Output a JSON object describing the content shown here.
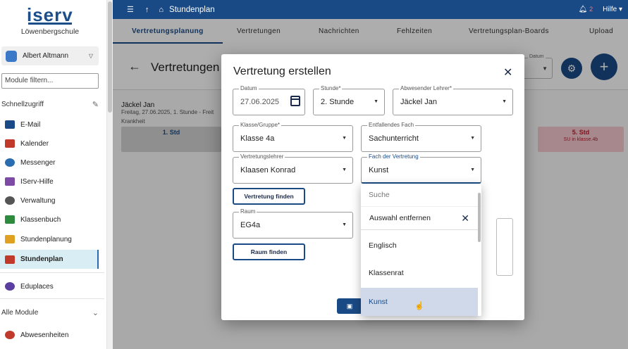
{
  "sidebar": {
    "logo": "iserv",
    "school": "Löwenbergschule",
    "user": "Albert Altmann",
    "filter_placeholder": "Module filtern...",
    "quick_access": "Schnellzugriff",
    "items": [
      {
        "label": "E-Mail",
        "icon": "mail-icon",
        "color": "#1a4a85"
      },
      {
        "label": "Kalender",
        "icon": "calendar-icon",
        "color": "#c0392b"
      },
      {
        "label": "Messenger",
        "icon": "messenger-icon",
        "color": "#2a6cb0"
      },
      {
        "label": "IServ-Hilfe",
        "icon": "help-icon",
        "color": "#7d4aa5"
      },
      {
        "label": "Verwaltung",
        "icon": "gear-icon",
        "color": "#555555"
      },
      {
        "label": "Klassenbuch",
        "icon": "classbook-icon",
        "color": "#2e8b3e"
      },
      {
        "label": "Stundenplanung",
        "icon": "planning-icon",
        "color": "#e0a020"
      },
      {
        "label": "Stundenplan",
        "icon": "timetable-icon",
        "color": "#c0392b"
      }
    ],
    "eduplaces": "Eduplaces",
    "all_modules": "Alle Module",
    "absences": "Abwesenheiten"
  },
  "topbar": {
    "title": "Stundenplan",
    "notifications": "2",
    "help": "Hilfe"
  },
  "tabs": [
    "Vertretungsplanung",
    "Vertretungen",
    "Nachrichten",
    "Fehlzeiten",
    "Vertretungsplan-Boards",
    "Upload"
  ],
  "page": {
    "title": "Vertretungen",
    "date_label": "Datum",
    "teacher": "Jäckel Jan",
    "teacher_sub": "Freitag, 27.06.2025, 1. Stunde - Freit",
    "reason": "Krankheit",
    "slot1": "1. Std",
    "slot5": "5. Std",
    "slot5_sub": "SU in klasse.4b"
  },
  "dialog": {
    "title": "Vertretung erstellen",
    "date_label": "Datum",
    "date_value": "27.06.2025",
    "hour_label": "Stunde*",
    "hour_value": "2. Stunde",
    "absent_label": "Abwesender Lehrer*",
    "absent_value": "Jäckel Jan",
    "class_label": "Klasse/Gruppe*",
    "class_value": "Klasse 4a",
    "subject_label": "Entfallendes Fach",
    "subject_value": "Sachunterricht",
    "sub_teacher_label": "Vertretungslehrer",
    "sub_teacher_value": "Klaasen Konrad",
    "sub_subject_label": "Fach der Vertretung",
    "sub_subject_value": "Kunst",
    "find_sub_button": "Vertretung finden",
    "room_label": "Raum",
    "room_value": "EG4a",
    "find_room_button": "Raum finden"
  },
  "dropdown": {
    "search_placeholder": "Suche",
    "remove": "Auswahl entfernen",
    "options": [
      "Englisch",
      "Klassenrat",
      "Kunst"
    ],
    "selected": "Kunst"
  }
}
